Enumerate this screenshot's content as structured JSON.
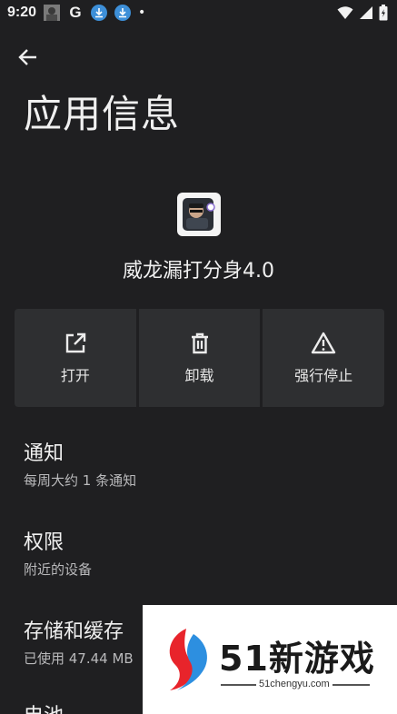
{
  "status_bar": {
    "time": "9:20",
    "icons": [
      "photo-app-icon",
      "google-icon",
      "download-icon",
      "download-icon",
      "notification-dot-icon",
      "wifi-icon",
      "signal-icon",
      "battery-icon"
    ],
    "google_letter": "G",
    "dot": "•"
  },
  "header": {
    "back_icon": "arrow-back-icon",
    "title": "应用信息"
  },
  "app": {
    "name": "威龙漏打分身4.0"
  },
  "actions": [
    {
      "label": "打开",
      "icon": "open-external-icon"
    },
    {
      "label": "卸载",
      "icon": "trash-icon"
    },
    {
      "label": "强行停止",
      "icon": "warning-icon"
    }
  ],
  "settings": [
    {
      "title": "通知",
      "subtitle": "每周大约 1 条通知"
    },
    {
      "title": "权限",
      "subtitle": "附近的设备"
    },
    {
      "title": "存储和缓存",
      "subtitle": "已使用 47.44 MB"
    },
    {
      "title": "电池",
      "subtitle": ""
    }
  ],
  "watermark": {
    "text": "51新游戏",
    "url": "51chengyu.com"
  },
  "colors": {
    "background": "#1f1f21",
    "action_tile": "#2e2f31",
    "text_primary": "#f0f0f0",
    "text_secondary": "#b9b9bb",
    "watermark_red": "#e8242b",
    "watermark_blue": "#2d8fe0"
  }
}
